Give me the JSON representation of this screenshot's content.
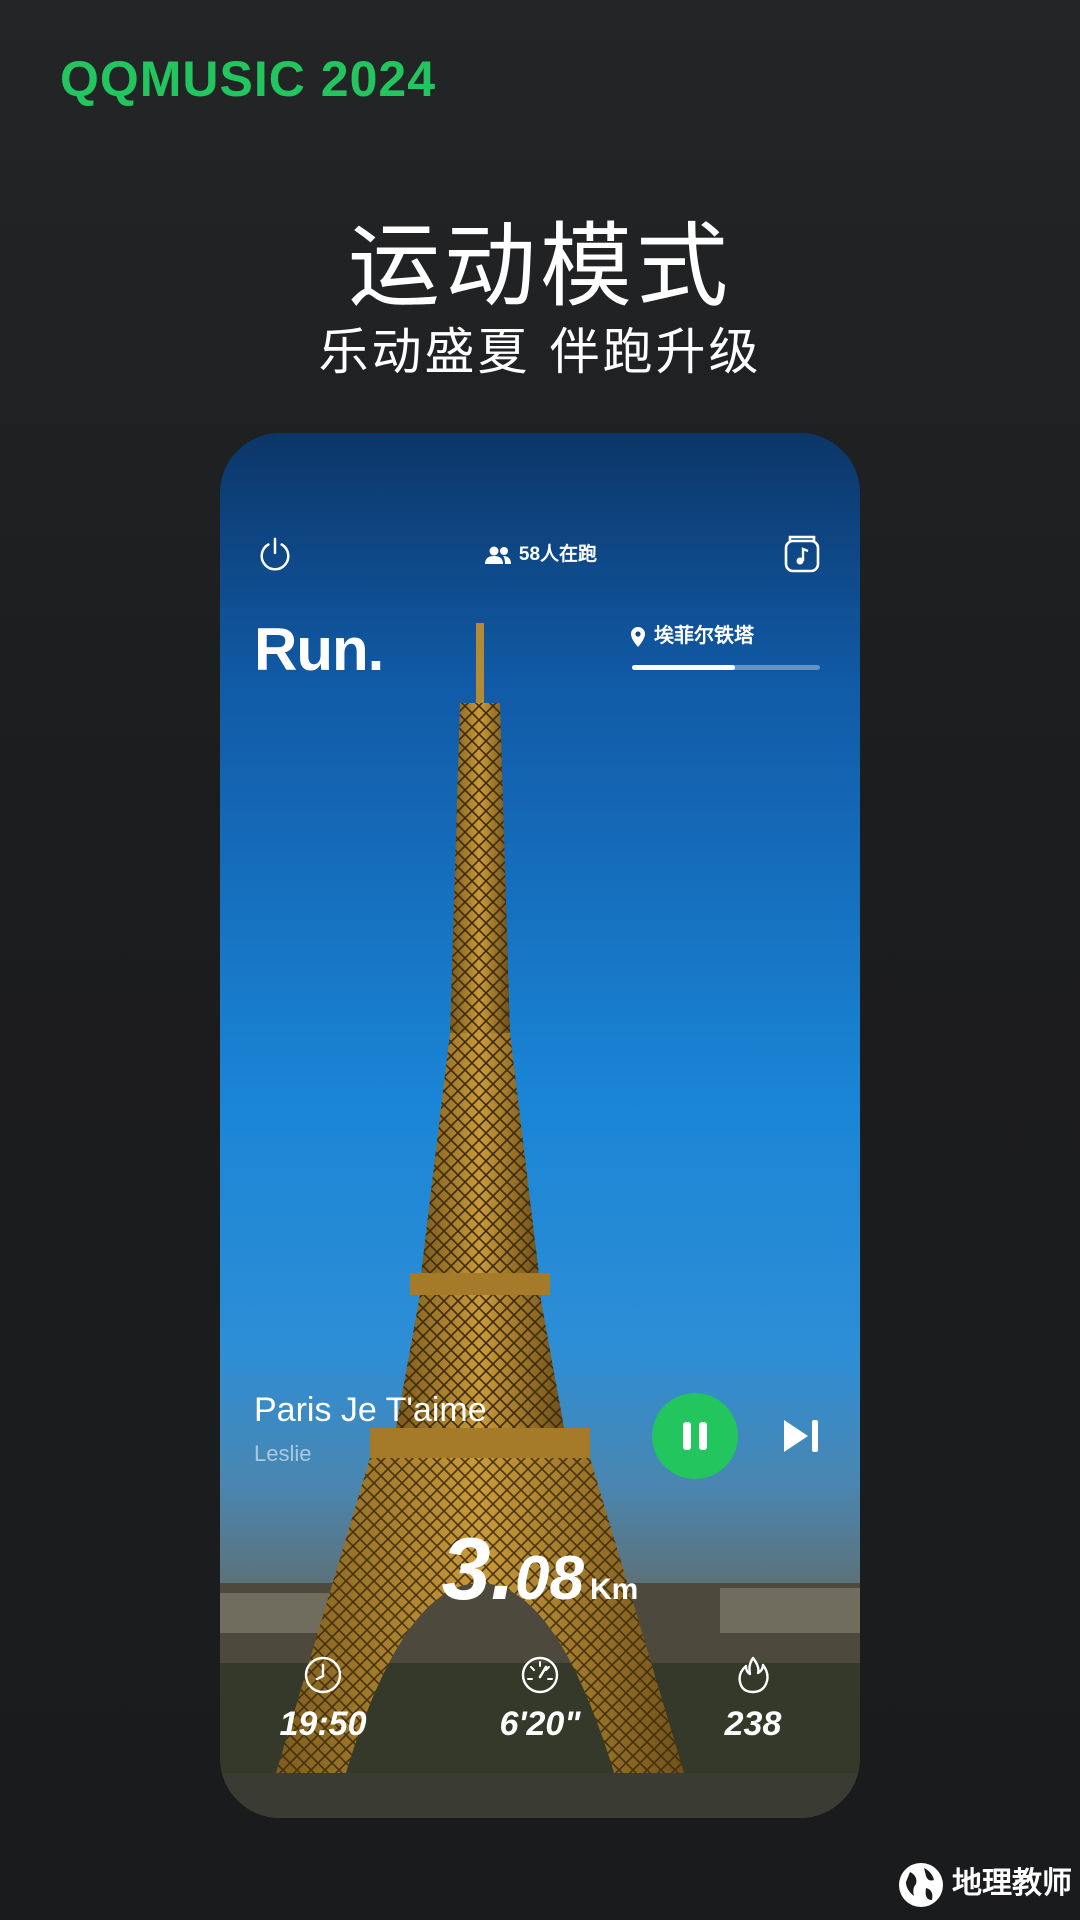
{
  "brand": "QQMUSIC 2024",
  "headline": {
    "title": "运动模式",
    "subtitle": "乐动盛夏  伴跑升级"
  },
  "phone": {
    "topbar": {
      "left_icon": "power-icon",
      "runners_count": "58人在跑",
      "runners_icon": "people-icon",
      "right_icon": "music-note-icon"
    },
    "run_logo": "Run.",
    "location": {
      "name": "埃菲尔铁塔",
      "icon": "pin-icon",
      "progress": 0.55
    },
    "now_playing": {
      "title": "Paris Je T'aime",
      "artist": "Leslie"
    },
    "distance": {
      "whole": "3.",
      "fraction": "08",
      "unit": "Km"
    },
    "stats": [
      {
        "icon": "clock-icon",
        "value": "19:50"
      },
      {
        "icon": "speedometer-icon",
        "value": "6'20\""
      },
      {
        "icon": "flame-icon",
        "value": "238"
      }
    ]
  },
  "watermark": "地理教师",
  "colors": {
    "accent": "#22c55e",
    "background": "#1c1d1f"
  }
}
